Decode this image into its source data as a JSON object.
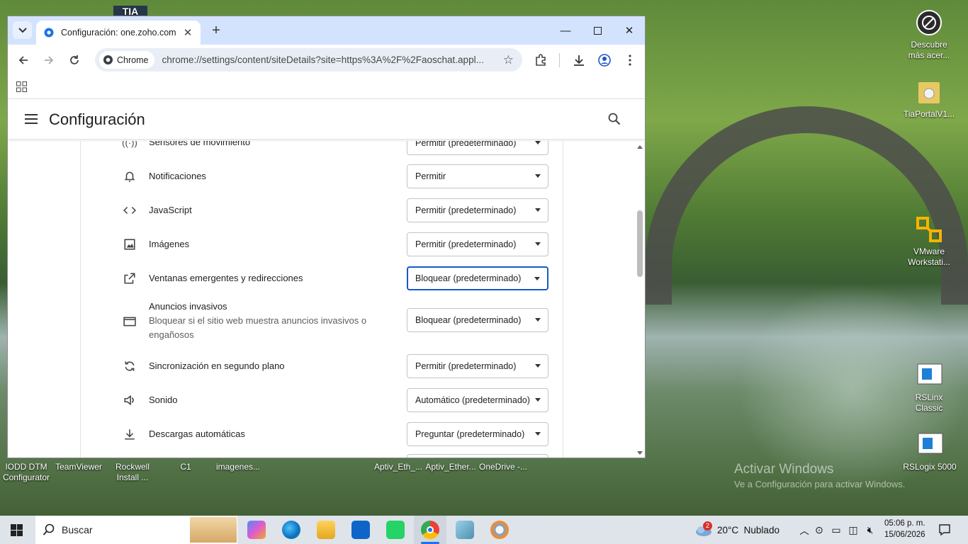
{
  "desktop": {
    "right_icons": [
      {
        "name": "Descubre más acer...",
        "line1": "Descubre",
        "line2": "más acer..."
      },
      {
        "name": "TiaPortalV1...",
        "line1": "TiaPortalV1...",
        "line2": ""
      },
      {
        "name": "VMware Workstati...",
        "line1": "VMware",
        "line2": "Workstati..."
      },
      {
        "name": "RSLinx Classic",
        "line1": "RSLinx",
        "line2": "Classic"
      },
      {
        "name": "RSLogix 5000",
        "line1": "RSLogix 5000",
        "line2": ""
      }
    ],
    "bottom_labels": [
      {
        "line1": "IODD DTM",
        "line2": "Configurator"
      },
      {
        "line1": "TeamViewer",
        "line2": ""
      },
      {
        "line1": "Rockwell",
        "line2": "Install ..."
      },
      {
        "line1": "C1",
        "line2": ""
      },
      {
        "line1": "imagenes...",
        "line2": ""
      },
      {
        "line1": "Aptiv_Eth_...",
        "line2": ""
      },
      {
        "line1": "Aptiv_Ether...",
        "line2": ""
      },
      {
        "line1": "OneDrive -...",
        "line2": ""
      }
    ],
    "top_label": "TIA",
    "watermark_title": "Activar Windows",
    "watermark_sub": "Ve a Configuración para activar Windows."
  },
  "browser": {
    "tab_title": "Configuración: one.zoho.com",
    "chip_label": "Chrome",
    "url": "chrome://settings/content/siteDetails?site=https%3A%2F%2Faoschat.appl...",
    "accent": "#d3e3fd"
  },
  "settings": {
    "header_title": "Configuración",
    "rows": [
      {
        "icon": "motion-sensors-icon",
        "label": "Sensores de movimiento",
        "sub": "",
        "value": "Permitir (predeterminado)"
      },
      {
        "icon": "bell-icon",
        "label": "Notificaciones",
        "sub": "",
        "value": "Permitir"
      },
      {
        "icon": "code-icon",
        "label": "JavaScript",
        "sub": "",
        "value": "Permitir (predeterminado)"
      },
      {
        "icon": "image-icon",
        "label": "Imágenes",
        "sub": "",
        "value": "Permitir (predeterminado)"
      },
      {
        "icon": "open-in-new-icon",
        "label": "Ventanas emergentes y redirecciones",
        "sub": "",
        "value": "Bloquear (predeterminado)"
      },
      {
        "icon": "window-icon",
        "label": "Anuncios invasivos",
        "sub": "Bloquear si el sitio web muestra anuncios invasivos o engañosos",
        "value": "Bloquear (predeterminado)"
      },
      {
        "icon": "sync-icon",
        "label": "Sincronización en segundo plano",
        "sub": "",
        "value": "Permitir (predeterminado)"
      },
      {
        "icon": "speaker-icon",
        "label": "Sonido",
        "sub": "",
        "value": "Automático (predeterminado)"
      },
      {
        "icon": "download-icon",
        "label": "Descargas automáticas",
        "sub": "",
        "value": "Preguntar (predeterminado)"
      }
    ]
  },
  "taskbar": {
    "search_label": "Buscar",
    "weather": "20°C  Nublado",
    "weather_badge": "2",
    "time": "05:06 p. m.",
    "date": "15/06/2026"
  }
}
